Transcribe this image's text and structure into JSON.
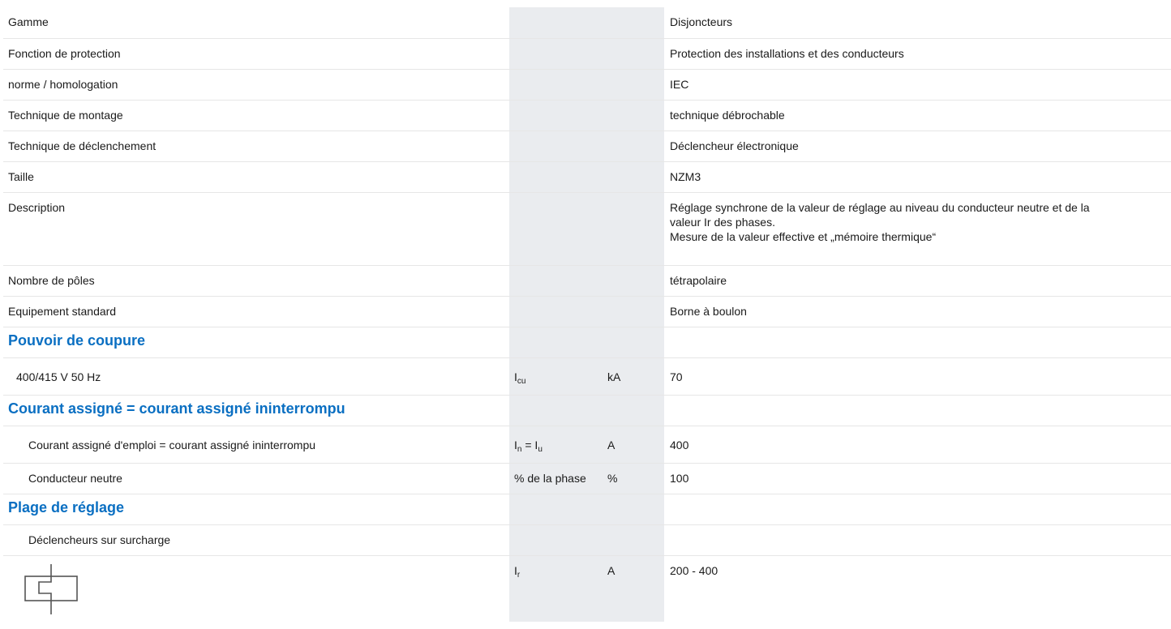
{
  "rows": {
    "gamme": {
      "label": "Gamme",
      "value": "Disjoncteurs"
    },
    "fonction": {
      "label": "Fonction de protection",
      "value": "Protection des installations et des conducteurs"
    },
    "norme": {
      "label": "norme / homologation",
      "value": "IEC"
    },
    "montage": {
      "label": "Technique de montage",
      "value": "technique débrochable"
    },
    "declenchement": {
      "label": "Technique de déclenchement",
      "value": "Déclencheur électronique"
    },
    "taille": {
      "label": "Taille",
      "value": "NZM3"
    },
    "description": {
      "label": "Description",
      "value_lines": [
        "Réglage synchrone de la valeur de réglage au niveau du conducteur neutre et de la",
        "valeur Ir des phases.",
        "Mesure de la valeur effective et „mémoire thermique“"
      ]
    },
    "poles": {
      "label": "Nombre de pôles",
      "value": "tétrapolaire"
    },
    "equipement": {
      "label": "Equipement standard",
      "value": "Borne à boulon"
    }
  },
  "sections": {
    "pouvoir": {
      "heading": "Pouvoir de coupure",
      "row": {
        "label": "400/415 V 50 Hz",
        "sym_main": "I",
        "sym_sub": "cu",
        "unit": "kA",
        "value": "70"
      }
    },
    "courant": {
      "heading": "Courant assigné = courant assigné ininterrompu",
      "row1": {
        "label": "Courant assigné d'emploi = courant assigné ininterrompu",
        "sym_a": "I",
        "sym_a_sub": "n",
        "sym_eq": " = ",
        "sym_b": "I",
        "sym_b_sub": "u",
        "unit": "A",
        "value": "400"
      },
      "row2": {
        "label": "Conducteur neutre",
        "sym": "% de la phase",
        "unit": "%",
        "value": "100"
      }
    },
    "plage": {
      "heading": "Plage de réglage",
      "sub_label": "Déclencheurs sur surcharge",
      "row": {
        "sym_main": "I",
        "sym_sub": "r",
        "unit": "A",
        "value": "200 - 400"
      }
    }
  },
  "icons": {
    "overload_symbol": "thermal-overload-release-icon"
  }
}
